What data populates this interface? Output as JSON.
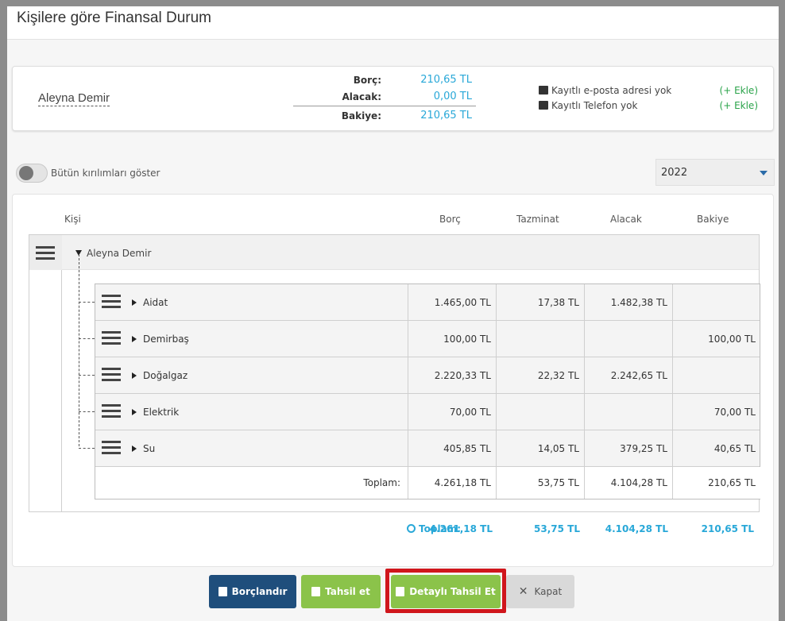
{
  "modal": {
    "title": "Kişilere göre Finansal Durum"
  },
  "summary": {
    "person_name": "Aleyna Demir",
    "borc_label": "Borç:",
    "borc_value": "210,65 TL",
    "alacak_label": "Alacak:",
    "alacak_value": "0,00 TL",
    "bakiye_label": "Bakiye:",
    "bakiye_value": "210,65 TL",
    "email_text": "Kayıtlı e-posta adresi yok",
    "phone_text": "Kayıtlı Telefon yok",
    "add_label": "(+ Ekle)"
  },
  "controls": {
    "toggle_label": "Bütün kırılımları göster",
    "year_selected": "2022"
  },
  "table": {
    "headers": [
      "Kişi",
      "Borç",
      "Tazminat",
      "Alacak",
      "Bakiye"
    ],
    "group_name": "Aleyna Demir",
    "rows": [
      {
        "name": "Aidat",
        "borc": "1.465,00 TL",
        "tazminat": "17,38 TL",
        "alacak": "1.482,38 TL",
        "bakiye": ""
      },
      {
        "name": "Demirbaş",
        "borc": "100,00 TL",
        "tazminat": "",
        "alacak": "",
        "bakiye": "100,00 TL"
      },
      {
        "name": "Doğalgaz",
        "borc": "2.220,33 TL",
        "tazminat": "22,32 TL",
        "alacak": "2.242,65 TL",
        "bakiye": ""
      },
      {
        "name": "Elektrik",
        "borc": "70,00 TL",
        "tazminat": "",
        "alacak": "",
        "bakiye": "70,00 TL"
      },
      {
        "name": "Su",
        "borc": "405,85 TL",
        "tazminat": "14,05 TL",
        "alacak": "379,25 TL",
        "bakiye": "40,65 TL"
      }
    ],
    "subtotal": {
      "label": "Toplam:",
      "borc": "4.261,18 TL",
      "tazminat": "53,75 TL",
      "alacak": "4.104,28 TL",
      "bakiye": "210,65 TL"
    },
    "grand_total": {
      "label": "Toplam:",
      "borc": "4.261,18 TL",
      "tazminat": "53,75 TL",
      "alacak": "4.104,28 TL",
      "bakiye": "210,65 TL"
    }
  },
  "buttons": {
    "borclandir": "Borçlandır",
    "tahsil_et": "Tahsil et",
    "detayli_tahsil_et": "Detaylı Tahsil Et",
    "kapat": "Kapat"
  },
  "colors": {
    "accent_blue": "#29a8d8",
    "green_button": "#8bc34a",
    "navy_button": "#1f4e7c",
    "highlight_red": "#d0161c",
    "add_link_green": "#2aa34a"
  }
}
